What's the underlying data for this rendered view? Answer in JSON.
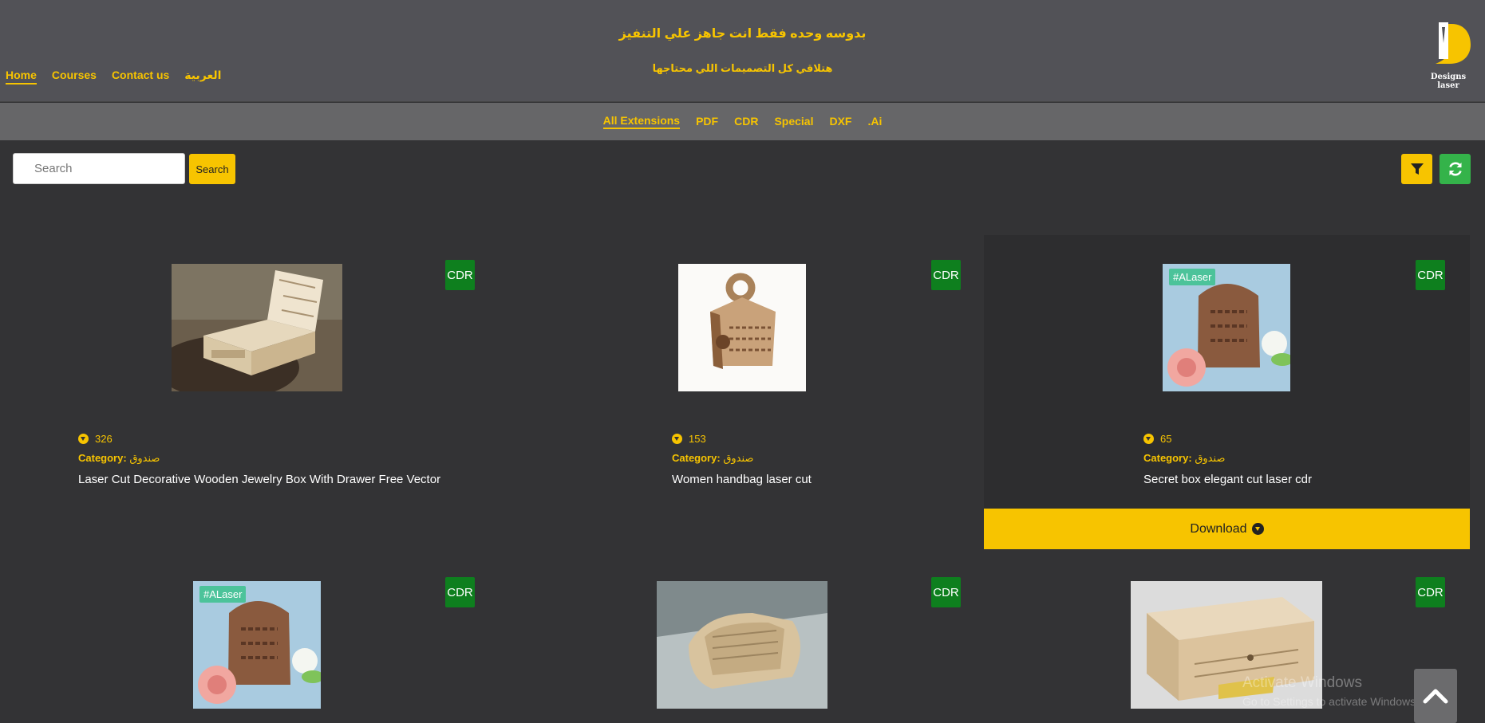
{
  "header": {
    "tagline_main": "بدوسه وحده فقط انت جاهز علي التنفيز",
    "tagline_sub": "هتلاقي كل التصميمات اللي محتاجها",
    "logo_text": "Designs laser",
    "nav": [
      {
        "label": "Home",
        "active": true
      },
      {
        "label": "Courses",
        "active": false
      },
      {
        "label": "Contact us",
        "active": false
      },
      {
        "label": "العربية",
        "active": false
      }
    ]
  },
  "extensions": [
    {
      "label": "All Extensions",
      "active": true
    },
    {
      "label": "PDF",
      "active": false
    },
    {
      "label": "CDR",
      "active": false
    },
    {
      "label": "Special",
      "active": false
    },
    {
      "label": "DXF",
      "active": false
    },
    {
      "label": ".Ai",
      "active": false
    }
  ],
  "search": {
    "placeholder": "Search",
    "value": "",
    "button_label": "Search",
    "filter_icon": "filter-icon",
    "refresh_icon": "refresh-icon"
  },
  "products": [
    {
      "ext": "CDR",
      "downloads": "326",
      "category_label": "Category:",
      "category": "صندوق",
      "title": "Laser Cut Decorative Wooden Jewelry Box With Drawer Free Vector"
    },
    {
      "ext": "CDR",
      "downloads": "153",
      "category_label": "Category:",
      "category": "صندوق",
      "title": "Women handbag laser cut"
    },
    {
      "ext": "CDR",
      "downloads": "65",
      "category_label": "Category:",
      "category": "صندوق",
      "title": "Secret box elegant cut laser cdr",
      "image_tag": "#ALaser"
    },
    {
      "ext": "CDR",
      "image_tag": "#ALaser"
    },
    {
      "ext": "CDR"
    },
    {
      "ext": "CDR"
    }
  ],
  "download_button": {
    "label": "Download",
    "icon": "download-circle-icon"
  },
  "watermark": {
    "line1": "Activate Windows",
    "line2": "Go to Settings to activate Windows."
  },
  "colors": {
    "accent": "#f7c400",
    "badge": "#0e7f1e",
    "refresh": "#34b34a",
    "background": "#333335",
    "header": "#525257"
  }
}
